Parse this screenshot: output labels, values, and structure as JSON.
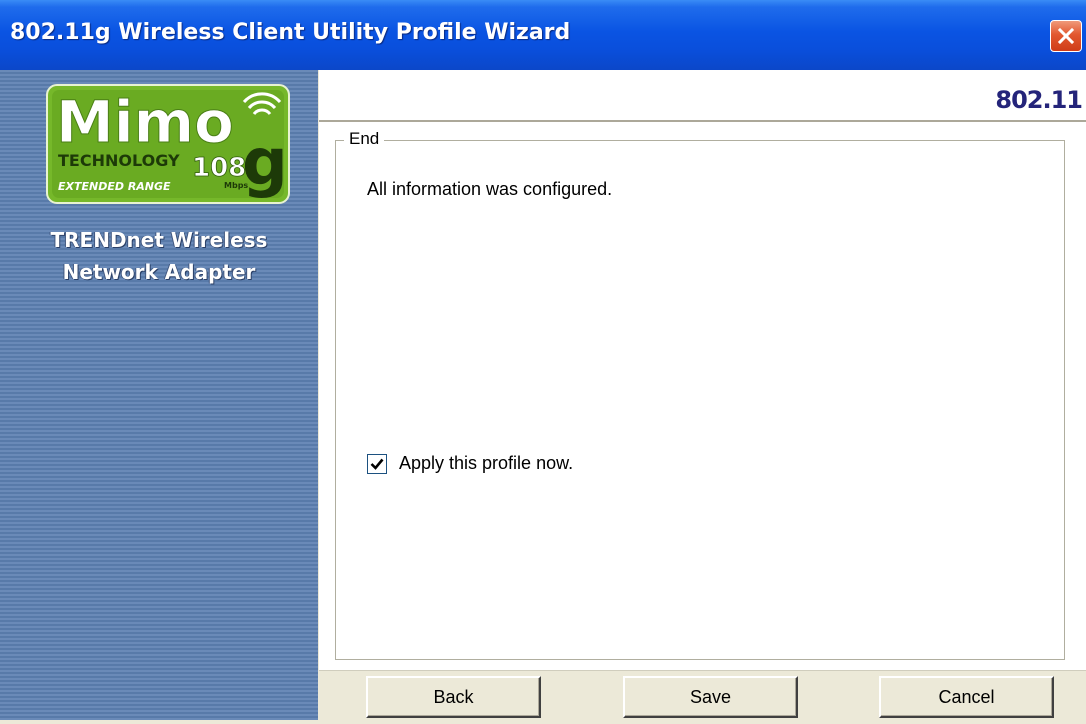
{
  "window": {
    "title": "802.11g Wireless Client Utility Profile Wizard",
    "close_icon": "close-icon"
  },
  "side_panel": {
    "logo": {
      "word": "Mimo",
      "technology": "TECHNOLOGY",
      "speed": "108",
      "speed_unit": "Mbps",
      "letter": "g",
      "tagline": "EXTENDED RANGE"
    },
    "brand_line1": "TRENDnet Wireless",
    "brand_line2": "Network Adapter"
  },
  "header": {
    "brand": "802.11"
  },
  "group": {
    "legend": "End",
    "message": "All information was configured.",
    "apply_checkbox": {
      "label": "Apply this profile now.",
      "checked": true
    }
  },
  "buttons": {
    "back": "Back",
    "save": "Save",
    "cancel": "Cancel"
  },
  "colors": {
    "titlebar": "#0a54e3",
    "side_panel": "#5f7fad",
    "logo_green": "#76b82a",
    "brand_navy": "#24247a"
  }
}
